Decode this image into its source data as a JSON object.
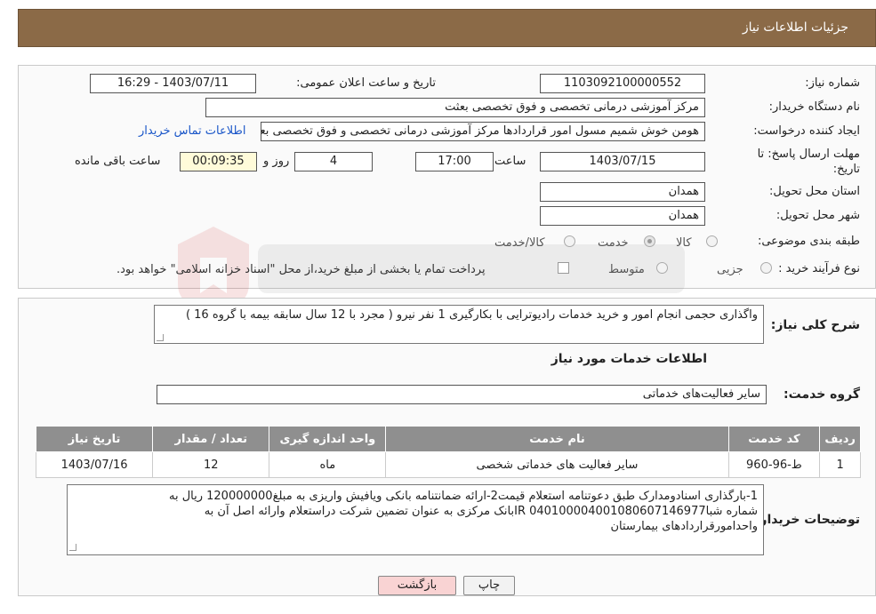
{
  "header": {
    "title": "جزئیات اطلاعات نیاز"
  },
  "form": {
    "need_number_label": "شماره نیاز:",
    "need_number": "1103092100000552",
    "announce_date_label": "تاریخ و ساعت اعلان عمومی:",
    "announce_date": "1403/07/11 - 16:29",
    "buyer_org_label": "نام دستگاه خریدار:",
    "buyer_org": "مرکز آموزشی درمانی تخصصی و فوق تخصصی بعثت",
    "creator_label": "ایجاد کننده درخواست:",
    "creator": "هومن خوش شمیم مسول امور قراردادها مرکز آموزشی درمانی تخصصی و فوق تخصصی بعثت",
    "buyer_contact_link": "اطلاعات تماس خریدار",
    "deadline_label": "مهلت ارسال پاسخ: تا تاریخ:",
    "deadline_date": "1403/07/15",
    "time_label": "ساعت",
    "deadline_time": "17:00",
    "days_value": "4",
    "days_label": "روز و",
    "remaining_time": "00:09:35",
    "remaining_label": "ساعت باقی مانده",
    "province_label": "استان محل تحویل:",
    "province": "همدان",
    "city_label": "شهر محل تحویل:",
    "city": "همدان",
    "category_label": "طبقه بندی موضوعی:",
    "category_options": [
      "کالا",
      "خدمت",
      "کالا/خدمت"
    ],
    "category_selected": "خدمت",
    "process_label": "نوع فرآیند خرید :",
    "process_options": [
      "جزیی",
      "متوسط"
    ],
    "process_note": "پرداخت تمام یا بخشی از مبلغ خرید،از محل \"اسناد خزانه اسلامی\" خواهد بود."
  },
  "description": {
    "label": "شرح کلی نیاز:",
    "text": "واگذاری حجمی انجام امور و خرید خدمات رادیوترایی با بکارگیری 1 نفر نیرو ( مجرد با 12 سال سابقه بیمه با گروه 16 )"
  },
  "services": {
    "section_title": "اطلاعات خدمات مورد نیاز",
    "group_label": "گروه خدمت:",
    "group_value": "سایر فعالیت‌های خدماتی",
    "columns": [
      "ردیف",
      "کد خدمت",
      "نام خدمت",
      "واحد اندازه گیری",
      "تعداد / مقدار",
      "تاریخ نیاز"
    ],
    "rows": [
      [
        "1",
        "ط-96-960",
        "سایر فعالیت های خدماتی شخصی",
        "ماه",
        "12",
        "1403/07/16"
      ]
    ]
  },
  "buyer_notes": {
    "label": "توضیحات خریدار:",
    "line1": "1-بارگذاری اسنادومدارک طبق دعوتنامه استعلام قیمت2-ارائه ضمانتنامه بانکی ویافیش واریزی به مبلغ120000000 ریال به",
    "line2": "شماره شباIR 040100004001080607146977بانک  مرکزی به عنوان تضمین شرکت دراستعلام وارائه اصل آن به",
    "line3": "واحدامورقراردادهای بیمارستان"
  },
  "buttons": {
    "print": "چاپ",
    "back": "بازگشت"
  },
  "colors": {
    "header_bg": "#8b6a47",
    "table_header_bg": "#8f8f8f",
    "link": "#1a56c8",
    "back_button_bg": "#f9d3d3"
  }
}
